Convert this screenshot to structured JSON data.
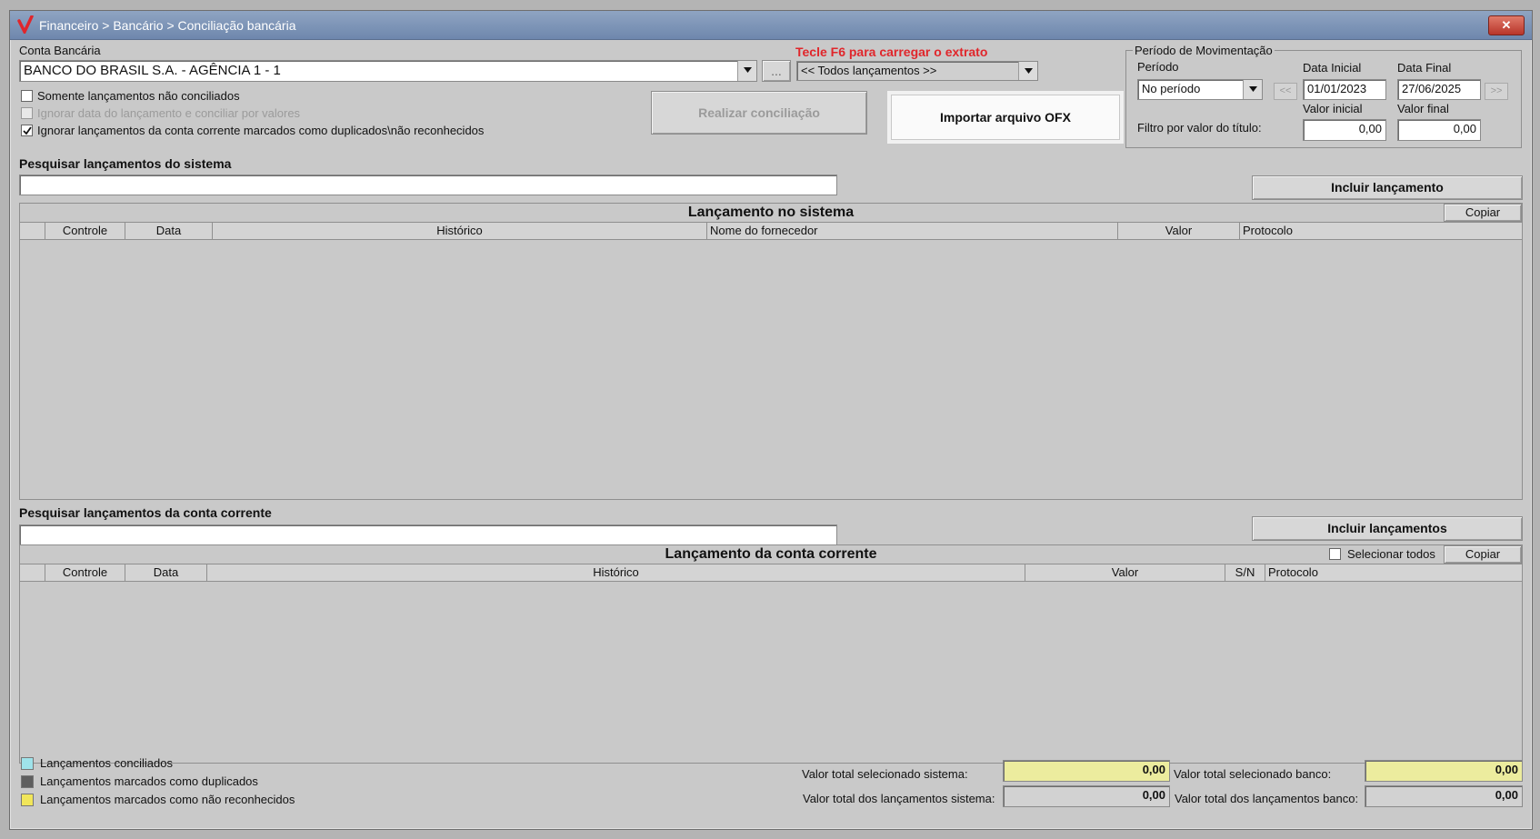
{
  "window": {
    "title": "Financeiro > Bancário > Conciliação bancária",
    "close_label": "✕"
  },
  "conta": {
    "label": "Conta Bancária",
    "value": "BANCO DO BRASIL S.A. - AGÊNCIA 1 - 1",
    "browse_label": "..."
  },
  "extrato": {
    "hint": "Tecle F6 para carregar o extrato",
    "filter_value": "<< Todos lançamentos >>"
  },
  "options": [
    {
      "label": "Somente lançamentos não conciliados",
      "checked": false,
      "enabled": true
    },
    {
      "label": "Ignorar data do lançamento e conciliar por valores",
      "checked": false,
      "enabled": false
    },
    {
      "label": "Ignorar lançamentos da conta corrente marcados como duplicados\\não reconhecidos",
      "checked": true,
      "enabled": true
    }
  ],
  "buttons": {
    "realizar": "Realizar conciliação",
    "importar": "Importar arquivo OFX",
    "incluir_lancamento": "Incluir lançamento",
    "incluir_lancamentos": "Incluir lançamentos",
    "copiar": "Copiar",
    "copiar2": "Copiar"
  },
  "periodo": {
    "legend": "Período de Movimentação",
    "periodo_label": "Período",
    "periodo_value": "No período",
    "data_inicial_label": "Data Inicial",
    "data_inicial": "01/01/2023",
    "data_final_label": "Data Final",
    "data_final": "27/06/2025",
    "prev": "<<",
    "next": ">>",
    "valor_inicial_label": "Valor inicial",
    "valor_final_label": "Valor final",
    "filtro_label": "Filtro por valor do título:",
    "valor_inicial": "0,00",
    "valor_final": "0,00"
  },
  "sistema": {
    "search_label": "Pesquisar lançamentos do sistema",
    "search_value": "",
    "grid_title": "Lançamento no sistema",
    "columns": [
      "Controle",
      "Data",
      "Histórico",
      "Nome do fornecedor",
      "Valor",
      "Protocolo"
    ]
  },
  "banco": {
    "search_label": "Pesquisar lançamentos da conta corrente",
    "search_value": "",
    "grid_title": "Lançamento da conta corrente",
    "select_all": "Selecionar todos",
    "columns": [
      "Controle",
      "Data",
      "Histórico",
      "Valor",
      "S/N",
      "Protocolo"
    ]
  },
  "legend_items": [
    {
      "label": "Lançamentos conciliados",
      "color": "#9fe3ea"
    },
    {
      "label": "Lançamentos marcados como duplicados",
      "color": "#5f5f5f"
    },
    {
      "label": "Lançamentos marcados como não reconhecidos",
      "color": "#f1e65a"
    }
  ],
  "totals": {
    "sel_sistema_label": "Valor total selecionado sistema:",
    "sel_sistema": "0,00",
    "tot_sistema_label": "Valor total dos lançamentos sistema:",
    "tot_sistema": "0,00",
    "sel_banco_label": "Valor total selecionado banco:",
    "sel_banco": "0,00",
    "tot_banco_label": "Valor total dos lançamentos banco:",
    "tot_banco": "0,00"
  },
  "colors": {
    "accent_red": "#e0262b",
    "title_bar": "#7c93b6"
  }
}
